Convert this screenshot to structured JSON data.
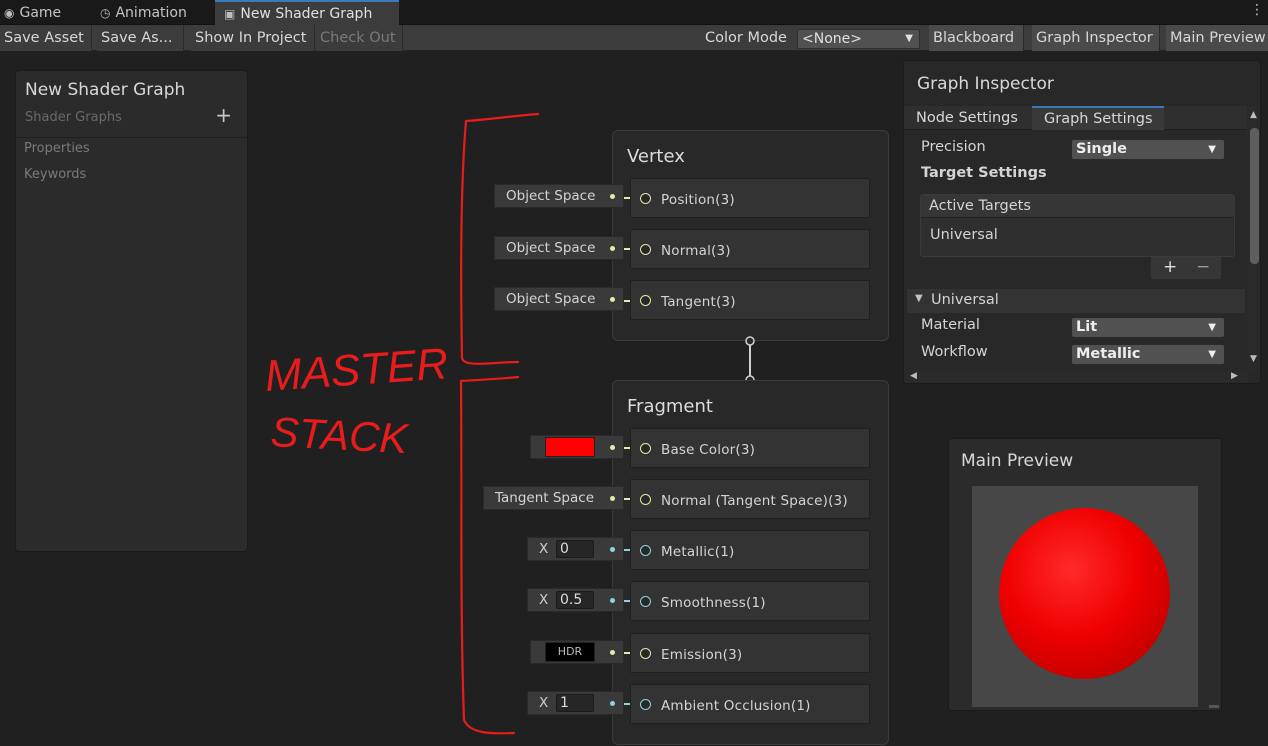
{
  "tabs": [
    {
      "label": "Game",
      "icon": "gamepad-icon"
    },
    {
      "label": "Animation",
      "icon": "clock-icon"
    },
    {
      "label": "New Shader Graph",
      "icon": "shader-graph-icon",
      "active": true
    }
  ],
  "toolbar": {
    "save_asset": "Save Asset",
    "save_as": "Save As...",
    "show_in_project": "Show In Project",
    "check_out": "Check Out",
    "color_mode_label": "Color Mode",
    "color_mode_value": "<None>",
    "blackboard": "Blackboard",
    "graph_inspector": "Graph Inspector",
    "main_preview": "Main Preview"
  },
  "blackboard": {
    "title": "New Shader Graph",
    "subtitle": "Shader Graphs",
    "add": "+",
    "sections": [
      "Properties",
      "Keywords"
    ]
  },
  "annotation": {
    "line1": "MASTER",
    "line2": "STACK",
    "color": "#e81c1c"
  },
  "vertex": {
    "title": "Vertex",
    "ports": [
      {
        "label": "Position(3)",
        "input": "Object Space"
      },
      {
        "label": "Normal(3)",
        "input": "Object Space"
      },
      {
        "label": "Tangent(3)",
        "input": "Object Space"
      }
    ]
  },
  "fragment": {
    "title": "Fragment",
    "ports": [
      {
        "label": "Base Color(3)",
        "input_color": "#ff0000"
      },
      {
        "label": "Normal (Tangent Space)(3)",
        "input": "Tangent Space"
      },
      {
        "label": "Metallic(1)",
        "x_label": "X",
        "x_value": "0"
      },
      {
        "label": "Smoothness(1)",
        "x_label": "X",
        "x_value": "0.5"
      },
      {
        "label": "Emission(3)",
        "input": "HDR"
      },
      {
        "label": "Ambient Occlusion(1)",
        "x_label": "X",
        "x_value": "1"
      }
    ]
  },
  "inspector": {
    "title": "Graph Inspector",
    "tabs": [
      "Node Settings",
      "Graph Settings"
    ],
    "precision_label": "Precision",
    "precision_value": "Single",
    "target_settings": "Target Settings",
    "active_targets": "Active Targets",
    "target_item": "Universal",
    "add": "+",
    "remove": "−",
    "universal_section": "Universal",
    "material_label": "Material",
    "material_value": "Lit",
    "workflow_label": "Workflow",
    "workflow_value": "Metallic"
  },
  "preview": {
    "title": "Main Preview",
    "sphere_color": "#ff0000"
  },
  "colors": {
    "accent": "#3a79bb",
    "wire_vector": "#e8e8a8",
    "wire_float": "#8ad5e0"
  }
}
